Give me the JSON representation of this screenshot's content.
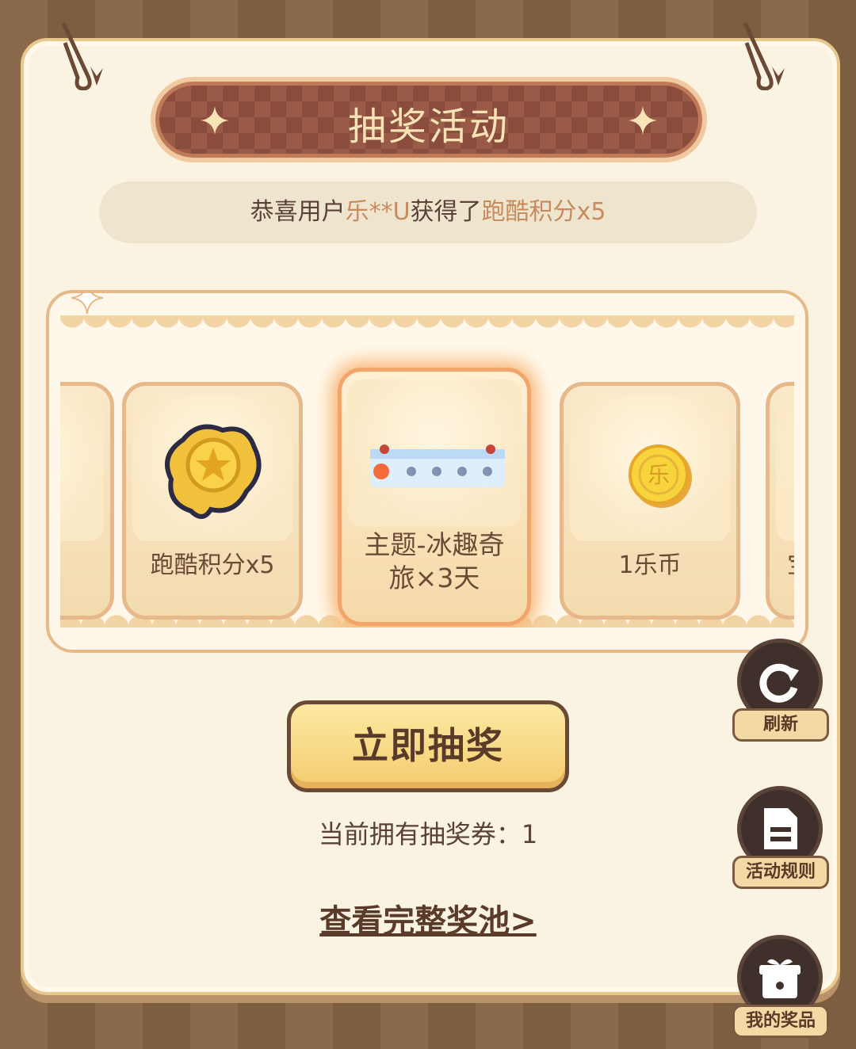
{
  "title": "抽奖活动",
  "ticker": {
    "prefix": "恭喜用户",
    "user": "乐**U",
    "middle": "获得了",
    "prize": "跑酷积分x5"
  },
  "prizes": [
    {
      "label": "跑酷积分x5",
      "icon": "star-badge-icon"
    },
    {
      "label": "主题-冰趣奇旅×3天",
      "icon": "theme-preview-icon"
    },
    {
      "label": "1乐币",
      "icon": "le-coin-icon"
    },
    {
      "label": "宝",
      "icon": ""
    }
  ],
  "draw_button": "立即抽奖",
  "tickets": {
    "label": "当前拥有抽奖券：",
    "count": "1"
  },
  "pool_link": "查看完整奖池>",
  "side_buttons": {
    "refresh": "刷新",
    "rules": "活动规则",
    "my_prizes": "我的奖品"
  },
  "colors": {
    "background": "#7d5e40",
    "card": "#fbf3e1",
    "accent": "#f3cc6e",
    "banner": "#8a4c3c",
    "highlight_text": "#c68b5e"
  }
}
